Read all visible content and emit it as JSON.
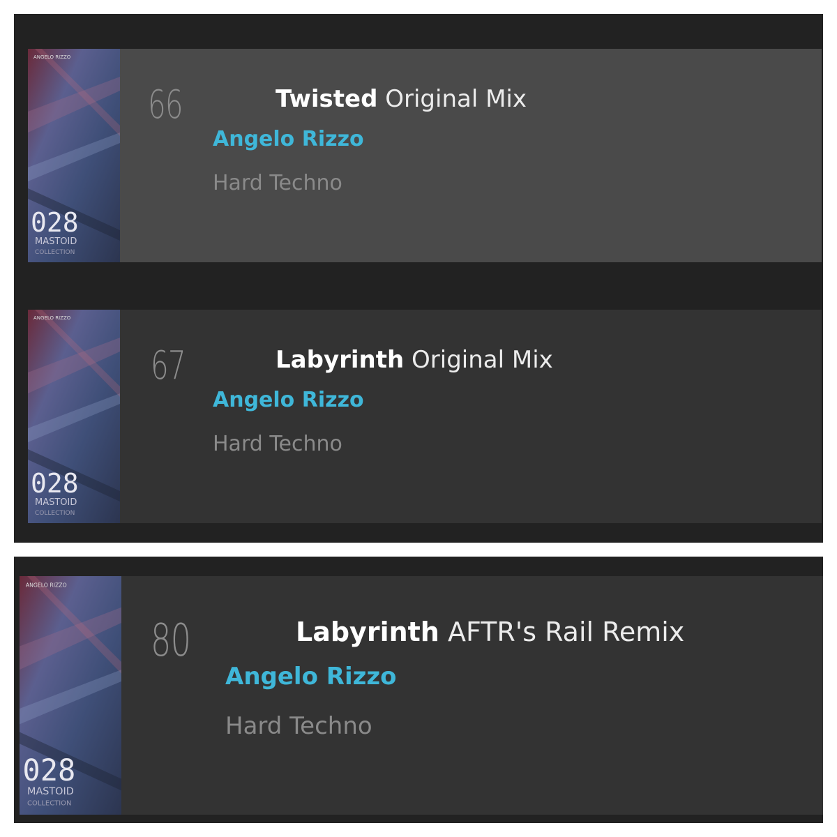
{
  "accent_color": "#3fb7d9",
  "artwork": {
    "number": "028",
    "label": "MASTOID",
    "sublabel": "COLLECTION",
    "header": "ANGELO RIZZO"
  },
  "tracks": [
    {
      "rank": "66",
      "title": "Twisted",
      "mix": "Original Mix",
      "artist": "Angelo Rizzo",
      "genre": "Hard Techno",
      "highlighted": true
    },
    {
      "rank": "67",
      "title": "Labyrinth",
      "mix": "Original Mix",
      "artist": "Angelo Rizzo",
      "genre": "Hard Techno",
      "highlighted": false
    },
    {
      "rank": "80",
      "title": "Labyrinth",
      "mix": "AFTR's Rail Remix",
      "artist": "Angelo Rizzo",
      "genre": "Hard Techno",
      "highlighted": false
    }
  ]
}
